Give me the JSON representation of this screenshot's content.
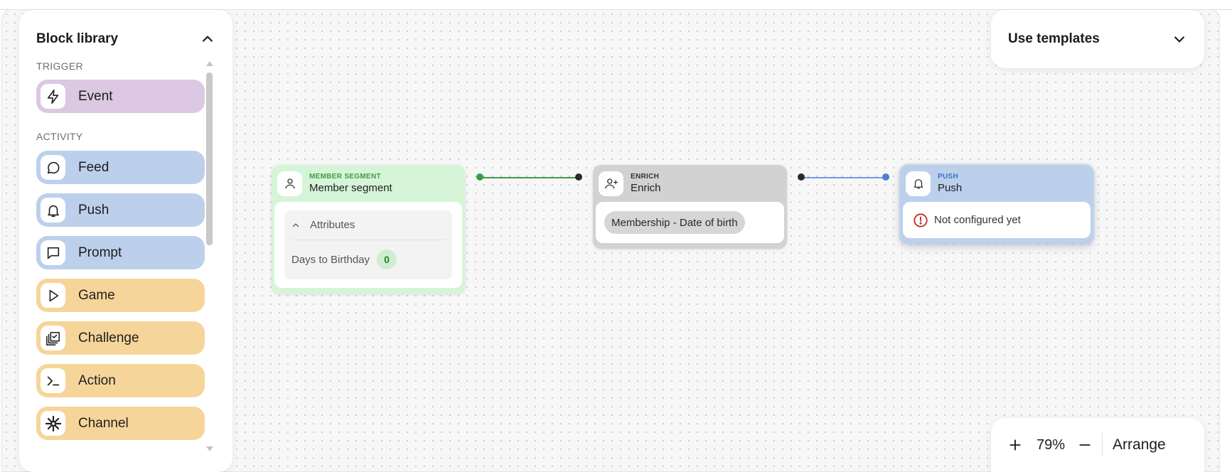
{
  "library": {
    "title": "Block library",
    "sections": [
      {
        "label": "TRIGGER",
        "items": [
          {
            "label": "Event",
            "icon": "lightning-icon",
            "color": "#dcc8e2"
          }
        ]
      },
      {
        "label": "ACTIVITY",
        "items": [
          {
            "label": "Feed",
            "icon": "chat-bubble-icon",
            "color": "#bcd0ec"
          },
          {
            "label": "Push",
            "icon": "bell-icon",
            "color": "#bcd0ec"
          },
          {
            "label": "Prompt",
            "icon": "message-square-icon",
            "color": "#bcd0ec"
          },
          {
            "label": "Game",
            "icon": "play-icon",
            "color": "#f6d59a"
          },
          {
            "label": "Challenge",
            "icon": "checklist-icon",
            "color": "#f6d59a"
          },
          {
            "label": "Action",
            "icon": "terminal-icon",
            "color": "#f6d59a"
          },
          {
            "label": "Channel",
            "icon": "asterisk-icon",
            "color": "#f6d59a"
          }
        ]
      }
    ]
  },
  "templates": {
    "label": "Use templates"
  },
  "zoom": {
    "value": "79%",
    "arrange_label": "Arrange"
  },
  "flow": {
    "nodes": [
      {
        "kicker": "MEMBER SEGMENT",
        "name": "Member segment",
        "color": "#d6f5d8",
        "attributes_label": "Attributes",
        "attribute_row": {
          "label": "Days to Birthday",
          "value": "0"
        }
      },
      {
        "kicker": "ENRICH",
        "name": "Enrich",
        "color": "#d2d2d2",
        "tag": "Membership - Date of birth"
      },
      {
        "kicker": "PUSH",
        "name": "Push",
        "color": "#bcd0ec",
        "status": "Not configured yet"
      }
    ],
    "connector_colors": [
      "#3f9a44",
      "#6f9ee0"
    ]
  }
}
